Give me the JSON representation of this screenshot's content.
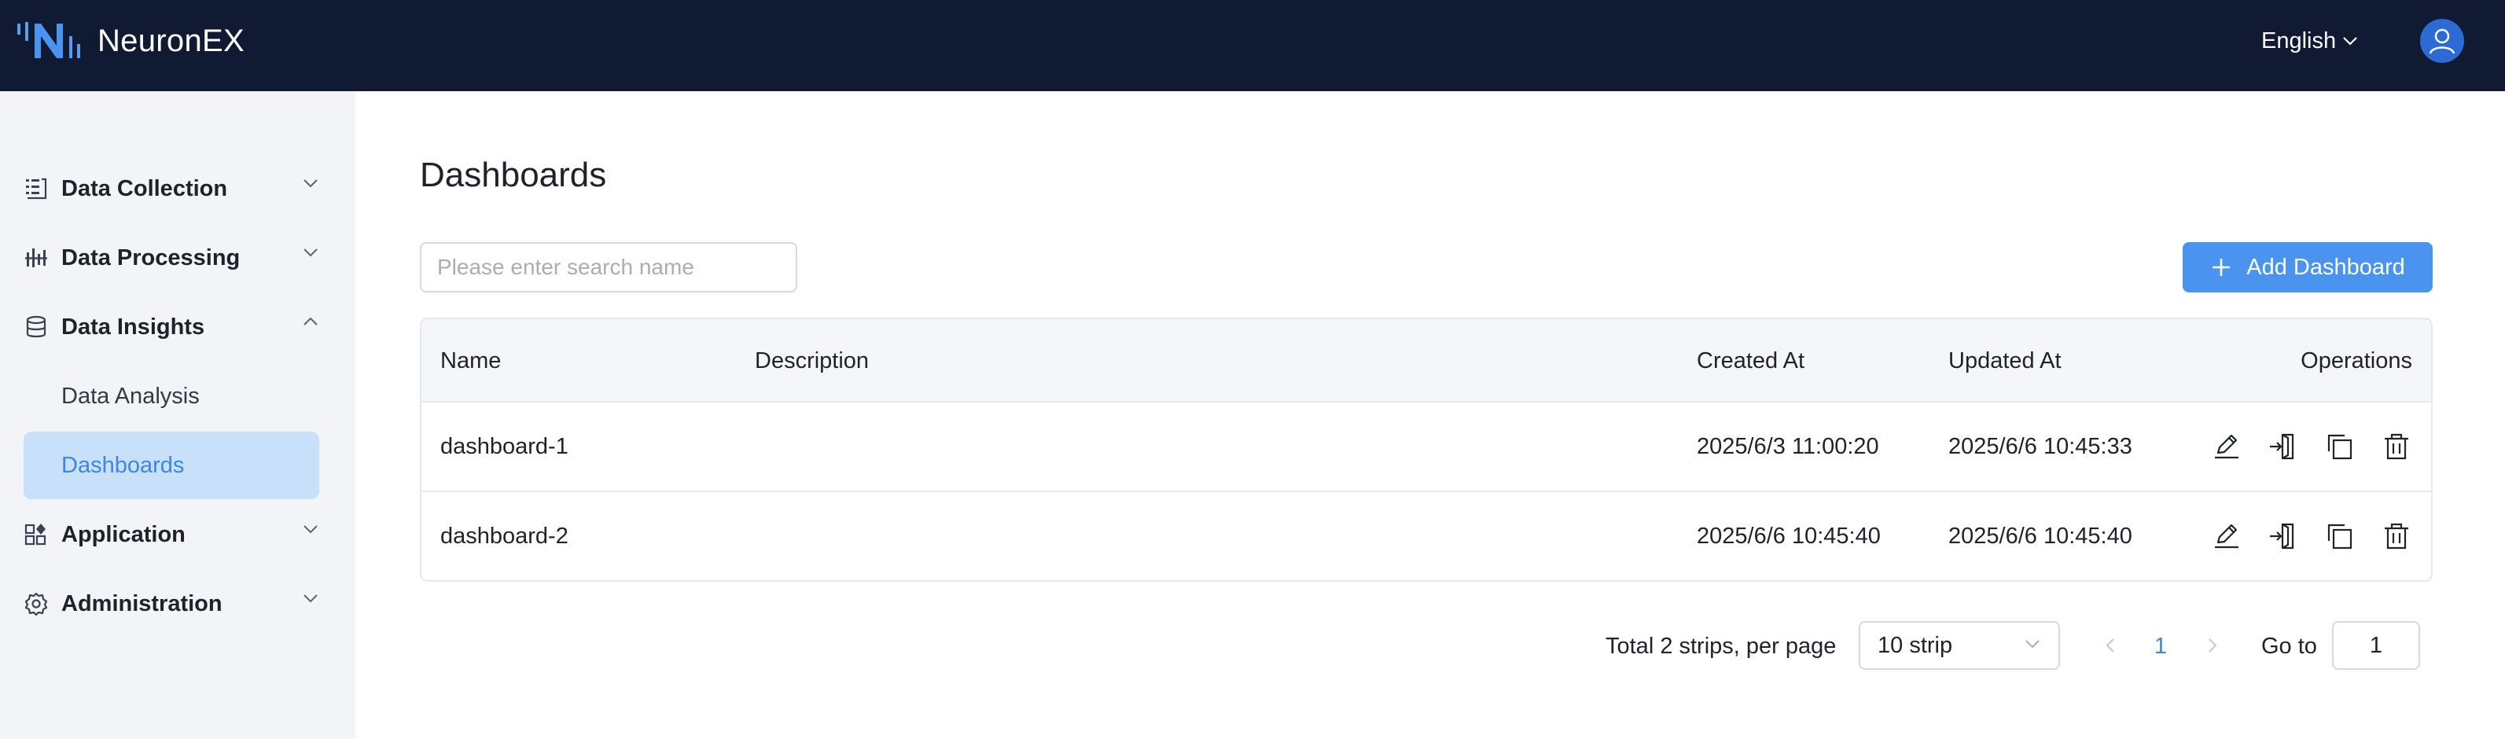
{
  "header": {
    "brand": "NeuronEX",
    "language": "English"
  },
  "sidebar": {
    "items": [
      {
        "label": "Data Collection",
        "icon": "data-collection-icon"
      },
      {
        "label": "Data Processing",
        "icon": "data-processing-icon"
      },
      {
        "label": "Data Insights",
        "icon": "database-icon",
        "expanded": true,
        "children": [
          {
            "label": "Data Analysis"
          },
          {
            "label": "Dashboards",
            "active": true
          }
        ]
      },
      {
        "label": "Application",
        "icon": "application-icon"
      },
      {
        "label": "Administration",
        "icon": "gear-icon"
      }
    ]
  },
  "main": {
    "title": "Dashboards",
    "search": {
      "placeholder": "Please enter search name",
      "value": ""
    },
    "add_button": "Add Dashboard",
    "table": {
      "columns": [
        "Name",
        "Description",
        "Created At",
        "Updated At",
        "Operations"
      ],
      "rows": [
        {
          "name": "dashboard-1",
          "description": "",
          "created_at": "2025/6/3 11:00:20",
          "updated_at": "2025/6/6 10:45:33"
        },
        {
          "name": "dashboard-2",
          "description": "",
          "created_at": "2025/6/6 10:45:40",
          "updated_at": "2025/6/6 10:45:40"
        }
      ],
      "operations": [
        "edit-icon",
        "import-icon",
        "copy-icon",
        "delete-icon"
      ]
    },
    "pagination": {
      "total_text": "Total 2 strips, per page",
      "page_size": "10 strip",
      "current_page": "1",
      "goto_label": "Go to",
      "goto_value": "1"
    }
  },
  "colors": {
    "header_bg": "#101a33",
    "sidebar_bg": "#f3f4f7",
    "accent": "#4a93ef",
    "active_bg": "#c9e0fb",
    "active_text": "#3d86e8"
  }
}
